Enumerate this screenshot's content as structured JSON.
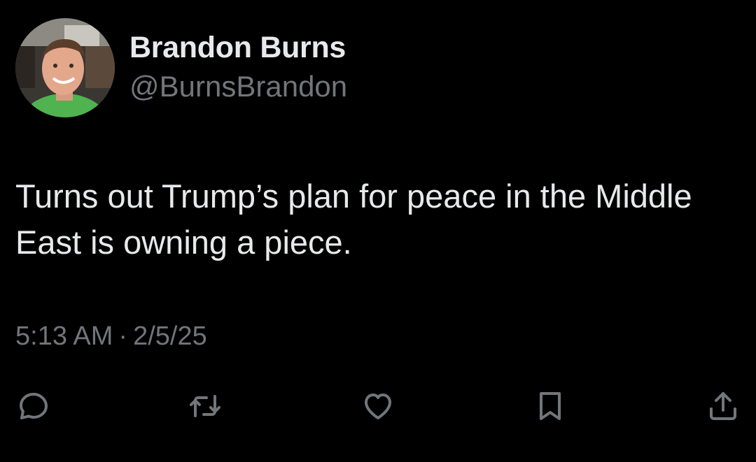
{
  "author": {
    "display_name": "Brandon Burns",
    "handle": "@BurnsBrandon",
    "avatar_icon": "avatar-photo"
  },
  "tweet": {
    "text": "Turns out Trump’s plan for peace in the Middle East is owning a piece.",
    "time": "5:13 AM",
    "separator": "·",
    "date": "2/5/25"
  },
  "actions": [
    {
      "name": "reply",
      "icon": "speech-bubble-icon"
    },
    {
      "name": "retweet",
      "icon": "retweet-icon"
    },
    {
      "name": "like",
      "icon": "heart-icon"
    },
    {
      "name": "bookmark",
      "icon": "bookmark-icon"
    },
    {
      "name": "share",
      "icon": "share-icon"
    }
  ],
  "colors": {
    "background": "#000000",
    "primary_text": "#e7e9ea",
    "secondary_text": "#71767b"
  }
}
